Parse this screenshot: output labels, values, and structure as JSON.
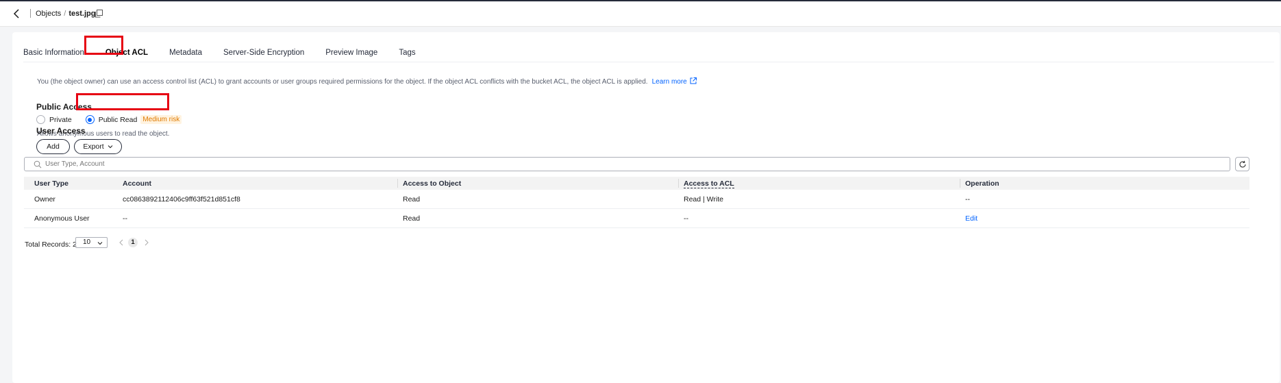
{
  "header": {
    "breadcrumb_parent": "Objects",
    "breadcrumb_separator": "/",
    "breadcrumb_current": "test.jpg"
  },
  "tabs": [
    {
      "label": "Basic Information",
      "active": false
    },
    {
      "label": "Object ACL",
      "active": true
    },
    {
      "label": "Metadata",
      "active": false
    },
    {
      "label": "Server-Side Encryption",
      "active": false
    },
    {
      "label": "Preview Image",
      "active": false
    },
    {
      "label": "Tags",
      "active": false
    }
  ],
  "description": {
    "text": "You (the object owner) can use an access control list (ACL) to grant accounts or user groups required permissions for the object. If the object ACL conflicts with the bucket ACL, the object ACL is applied.",
    "link": "Learn more"
  },
  "public_access": {
    "title": "Public Access",
    "options": [
      {
        "label": "Private",
        "selected": false
      },
      {
        "label": "Public Read",
        "selected": true,
        "badge": "Medium risk"
      }
    ],
    "hint": "Allows anonymous users to read the object."
  },
  "user_access": {
    "title": "User Access",
    "add_label": "Add",
    "export_label": "Export",
    "search_placeholder": "User Type, Account"
  },
  "table": {
    "columns": [
      "User Type",
      "Account",
      "Access to Object",
      "Access to ACL",
      "Operation"
    ],
    "rows": [
      {
        "user_type": "Owner",
        "account": "cc0863892112406c9ff63f521d851cf8",
        "access_object": "Read",
        "access_acl": "Read | Write",
        "operation": "--"
      },
      {
        "user_type": "Anonymous User",
        "account": "--",
        "access_object": "Read",
        "access_acl": "--",
        "operation": "Edit"
      }
    ]
  },
  "pagination": {
    "total_label": "Total Records: 2",
    "page_size": "10",
    "current_page": "1"
  },
  "colors": {
    "accent": "#0062ff",
    "highlight": "#e60012",
    "risk_text": "#e07a00",
    "risk_bg": "#fff3e0"
  }
}
